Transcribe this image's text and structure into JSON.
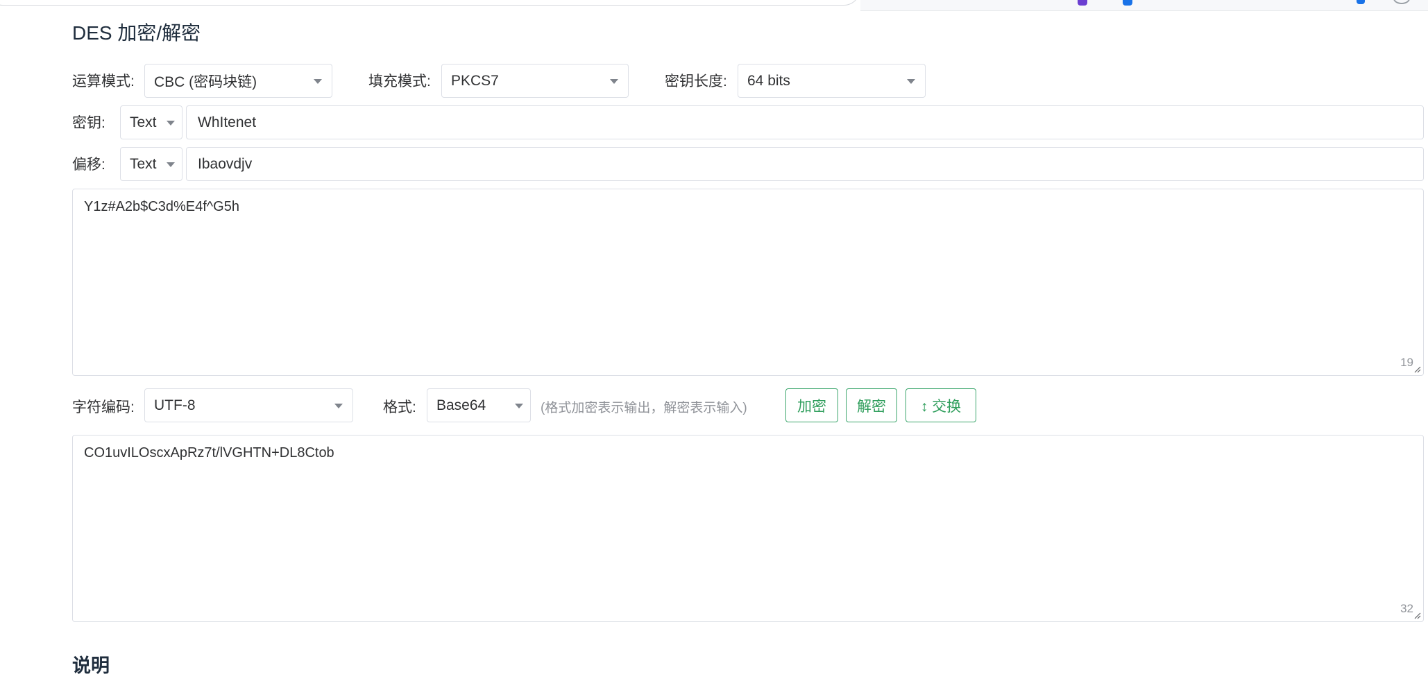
{
  "page": {
    "title": "DES 加密/解密"
  },
  "options": {
    "mode_label": "运算模式:",
    "mode_value": "CBC (密码块链)",
    "padding_label": "填充模式:",
    "padding_value": "PKCS7",
    "keylen_label": "密钥长度:",
    "keylen_value": "64 bits"
  },
  "key": {
    "label": "密钥:",
    "type": "Text",
    "value": "WhItenet"
  },
  "iv": {
    "label": "偏移:",
    "type": "Text",
    "value": "Ibaovdjv"
  },
  "input_text": {
    "value": "Y1z#A2b$C3d%E4f^G5h",
    "count": "19"
  },
  "encoding": {
    "charset_label": "字符编码:",
    "charset_value": "UTF-8",
    "format_label": "格式:",
    "format_value": "Base64",
    "hint": "(格式加密表示输出，解密表示输入)"
  },
  "actions": {
    "encrypt": "加密",
    "decrypt": "解密",
    "swap": "↕ 交换"
  },
  "output_text": {
    "value": "CO1uvILOscxApRz7t/lVGHTN+DL8Ctob",
    "count": "32"
  },
  "notes": {
    "heading": "说明"
  },
  "colors": {
    "accent": "#2f9e5c",
    "border": "#dcdfe6",
    "text": "#303133"
  }
}
